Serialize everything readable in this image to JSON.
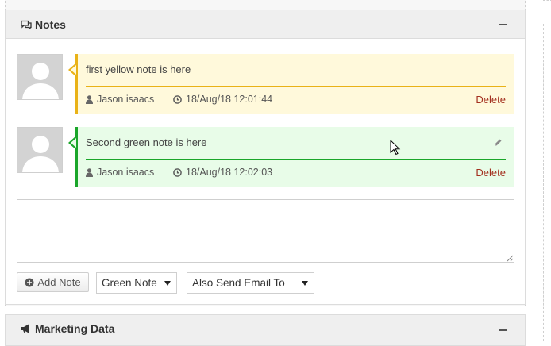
{
  "notes_panel": {
    "title": "Notes",
    "collapse_icon": "minus-icon"
  },
  "notes": [
    {
      "text": "first yellow note is here",
      "author": "Jason isaacs",
      "timestamp": "18/Aug/18 12:01:44",
      "delete_label": "Delete",
      "color": "#e9b217",
      "bg": "#fff9db"
    },
    {
      "text": "Second green note is here",
      "author": "Jason isaacs",
      "timestamp": "18/Aug/18 12:02:03",
      "delete_label": "Delete",
      "color": "#1aa62a",
      "bg": "#e8fce8",
      "edit_icon": "pencil-icon"
    }
  ],
  "composer": {
    "textarea_value": "",
    "add_button_label": "Add Note",
    "note_type_selected": "Green Note",
    "email_select_selected": "Also Send Email To"
  },
  "marketing_panel": {
    "title": "Marketing Data",
    "icon": "bullhorn-icon"
  }
}
